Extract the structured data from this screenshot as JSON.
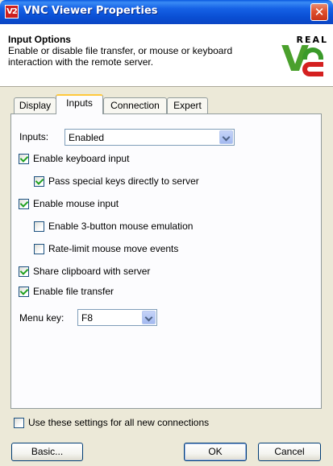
{
  "window": {
    "title": "VNC Viewer Properties",
    "icon_text": "V2",
    "close_glyph": "✕"
  },
  "header": {
    "title": "Input Options",
    "description": "Enable or disable file transfer, or mouse or keyboard interaction with the remote server.",
    "logo": {
      "top_text": "REAL",
      "letter": "V",
      "icon": "realvnc-logo-icon",
      "colors": {
        "green": "#4aa02c",
        "red": "#d42020"
      }
    }
  },
  "tabs": [
    {
      "label": "Display",
      "active": false
    },
    {
      "label": "Inputs",
      "active": true
    },
    {
      "label": "Connection",
      "active": false
    },
    {
      "label": "Expert",
      "active": false
    }
  ],
  "inputs_field": {
    "label": "Inputs:",
    "value": "Enabled"
  },
  "options": {
    "enable_keyboard": {
      "label": "Enable keyboard input",
      "checked": true
    },
    "pass_special_keys": {
      "label": "Pass special keys directly to server",
      "checked": true
    },
    "enable_mouse": {
      "label": "Enable mouse input",
      "checked": true
    },
    "three_button": {
      "label": "Enable 3-button mouse emulation",
      "checked": false
    },
    "rate_limit": {
      "label": "Rate-limit mouse move events",
      "checked": false
    },
    "share_clipboard": {
      "label": "Share clipboard with server",
      "checked": true
    },
    "file_transfer": {
      "label": "Enable file transfer",
      "checked": true
    }
  },
  "menu_key": {
    "label": "Menu key:",
    "value": "F8"
  },
  "use_for_all": {
    "label": "Use these settings for all new connections",
    "checked": false
  },
  "buttons": {
    "basic": "Basic...",
    "ok": "OK",
    "cancel": "Cancel"
  },
  "colors": {
    "titlebar": "#0a4fd4",
    "dialog_bg": "#ece9d8",
    "check_green": "#21a121",
    "close_red": "#e0502d"
  }
}
